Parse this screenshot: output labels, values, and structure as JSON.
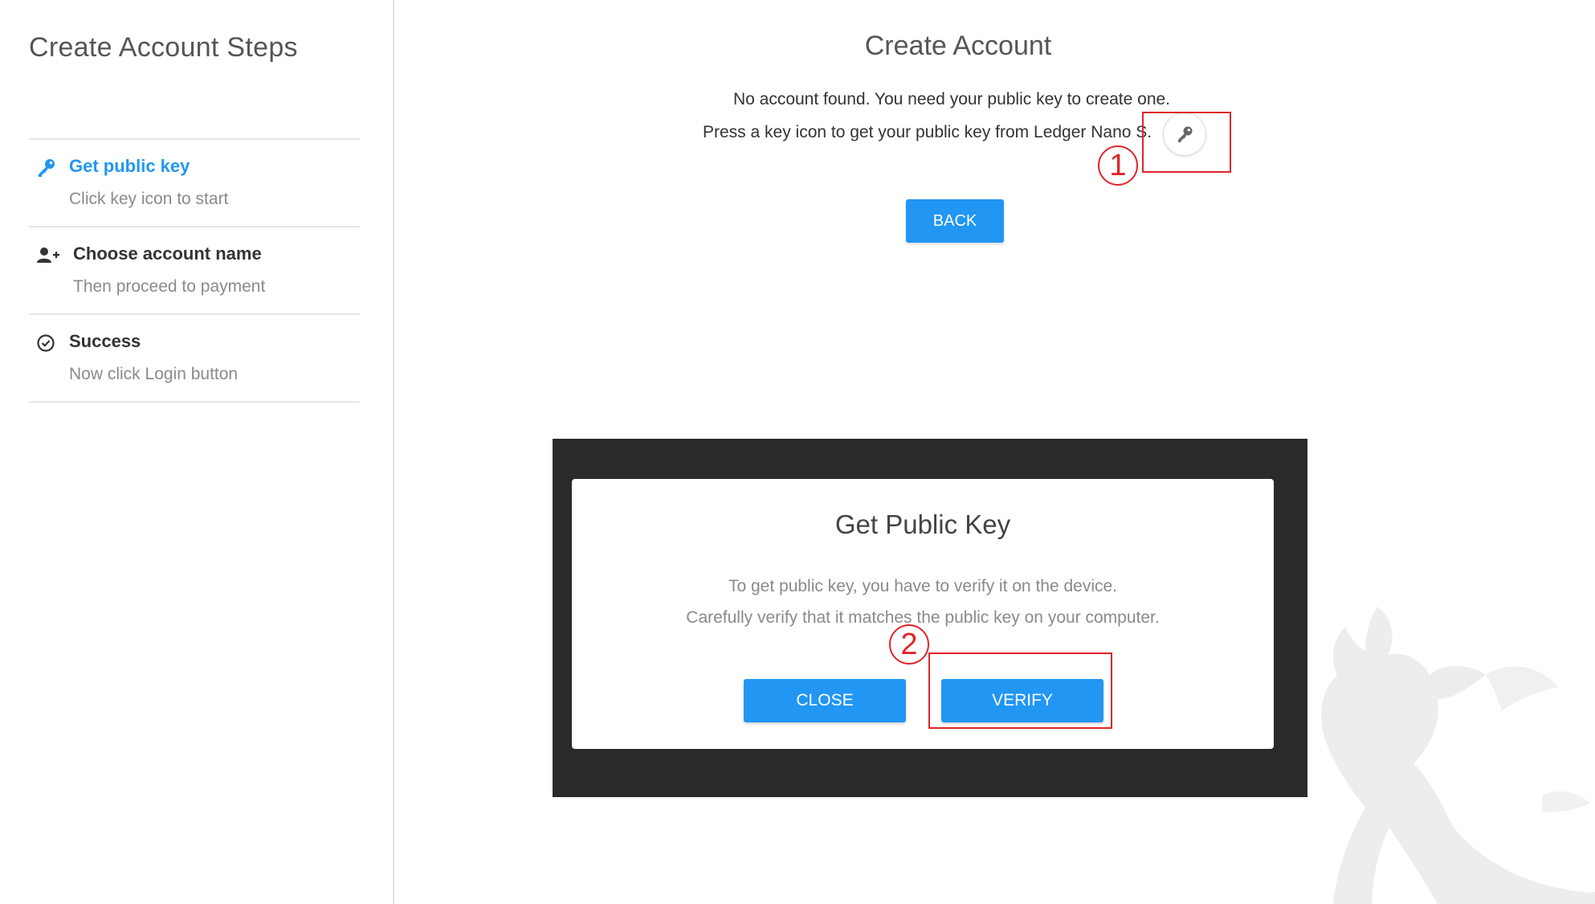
{
  "sidebar": {
    "title": "Create Account Steps",
    "steps": [
      {
        "title": "Get public key",
        "description": "Click key icon to start",
        "icon": "key-icon",
        "active": true
      },
      {
        "title": "Choose account name",
        "description": "Then proceed to payment",
        "icon": "add-user-icon",
        "active": false
      },
      {
        "title": "Success",
        "description": "Now click Login button",
        "icon": "check-circle-icon",
        "active": false
      }
    ]
  },
  "main": {
    "title": "Create Account",
    "message_line1": "No account found. You need your public key to create one.",
    "message_line2": "Press a key icon to get your public key from Ledger Nano S.",
    "key_button_icon": "key-icon",
    "back_label": "BACK"
  },
  "dialog": {
    "title": "Get Public Key",
    "text_line1": "To get public key, you have to verify it on the device.",
    "text_line2": "Carefully verify that it matches the public key on your computer.",
    "close_label": "CLOSE",
    "verify_label": "VERIFY"
  },
  "annotations": {
    "marker1": "1",
    "marker2": "2"
  },
  "colors": {
    "accent": "#2196f3",
    "annotation": "#e0242a",
    "overlay": "#2a2a2a"
  }
}
